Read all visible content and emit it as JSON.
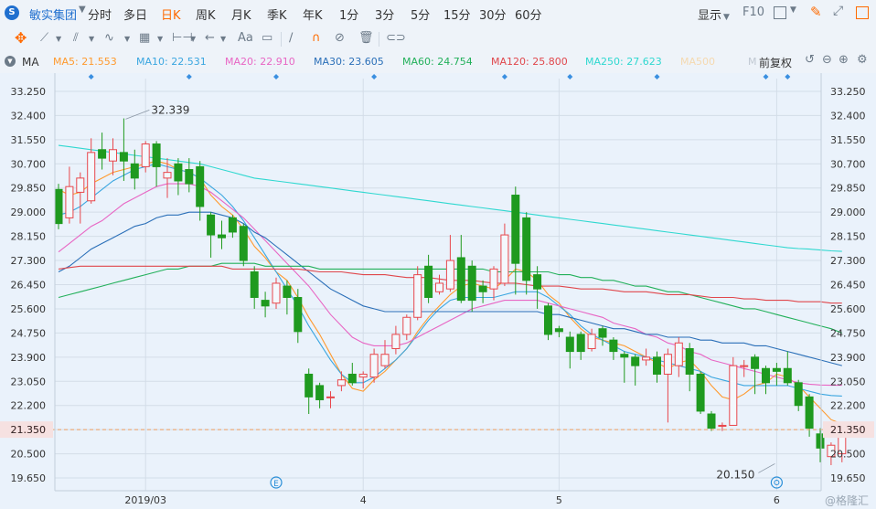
{
  "toolbar": {
    "logo_text": "S",
    "stock_name": "敏实集团",
    "periods": [
      "分时",
      "多日",
      "日K",
      "周K",
      "月K",
      "季K",
      "年K",
      "1分",
      "3分",
      "5分",
      "15分",
      "30分",
      "60分"
    ],
    "active_period": "日K",
    "display_label": "显示",
    "f10_label": "F10"
  },
  "drawing_tools": {
    "text_tool_label": "Aa"
  },
  "indicator_bar": {
    "indicator": "MA",
    "adjust_label": "前复权",
    "ma_items": [
      {
        "label": "MA5: 21.553",
        "color": "#ff9a2e"
      },
      {
        "label": "MA10: 22.531",
        "color": "#3aa6e0"
      },
      {
        "label": "MA20: 22.910",
        "color": "#e866c4"
      },
      {
        "label": "MA30: 23.605",
        "color": "#2a6fb8"
      },
      {
        "label": "MA60: 24.754",
        "color": "#22b05a"
      },
      {
        "label": "MA120: 25.800",
        "color": "#e0474c"
      },
      {
        "label": "MA250: 27.623",
        "color": "#2fd8d0"
      },
      {
        "label": "MA500",
        "color": "#f5d9b0"
      },
      {
        "label": "M",
        "color": "#c0c8d2"
      }
    ]
  },
  "chart_data": {
    "type": "candlestick",
    "ylim": [
      19.2,
      33.7
    ],
    "y_ticks": [
      "33.250",
      "32.400",
      "31.550",
      "30.700",
      "29.850",
      "29.000",
      "28.150",
      "27.300",
      "26.450",
      "25.600",
      "24.750",
      "23.900",
      "23.050",
      "22.200",
      "21.350",
      "20.500",
      "19.650"
    ],
    "x_labels": [
      {
        "label": "2019/03",
        "index": 8
      },
      {
        "label": "4",
        "index": 28
      },
      {
        "label": "5",
        "index": 46
      },
      {
        "label": "6",
        "index": 66
      }
    ],
    "current_price": "21.350",
    "high_annotation": {
      "label": "32.339",
      "index": 6
    },
    "low_annotation": {
      "label": "20.150",
      "index": 66
    },
    "event_markers": {
      "E_index": 20,
      "Q_index": 66
    },
    "top_markers_indices": [
      3,
      12,
      20,
      29,
      41,
      47,
      55,
      65,
      67
    ],
    "colors": {
      "up": "#e8474c",
      "down": "#1f9a1f",
      "bg": "#eaf2fb",
      "grid": "#d3dde8"
    },
    "candles": [
      [
        29.8,
        28.6,
        28.4,
        30.0
      ],
      [
        28.8,
        29.9,
        28.6,
        30.6
      ],
      [
        29.7,
        30.2,
        28.6,
        30.4
      ],
      [
        29.4,
        31.1,
        29.3,
        31.6
      ],
      [
        31.2,
        30.9,
        30.5,
        31.8
      ],
      [
        30.8,
        31.2,
        30.3,
        31.6
      ],
      [
        31.1,
        30.8,
        30.1,
        32.3
      ],
      [
        30.7,
        30.2,
        29.8,
        31.2
      ],
      [
        30.6,
        31.4,
        30.4,
        31.5
      ],
      [
        31.4,
        30.6,
        29.9,
        31.5
      ],
      [
        30.2,
        30.4,
        29.5,
        30.9
      ],
      [
        30.7,
        30.1,
        29.6,
        30.9
      ],
      [
        30.5,
        30.0,
        29.7,
        30.9
      ],
      [
        30.6,
        29.2,
        28.7,
        30.8
      ],
      [
        28.9,
        28.2,
        27.4,
        29.0
      ],
      [
        28.2,
        28.1,
        27.7,
        28.7
      ],
      [
        28.8,
        28.3,
        28.1,
        28.9
      ],
      [
        28.5,
        27.3,
        27.1,
        28.6
      ],
      [
        26.9,
        26.0,
        25.6,
        27.1
      ],
      [
        25.9,
        25.7,
        25.3,
        26.2
      ],
      [
        25.8,
        26.5,
        25.6,
        26.7
      ],
      [
        26.4,
        26.0,
        25.4,
        26.6
      ],
      [
        26.0,
        24.8,
        24.4,
        26.3
      ],
      [
        23.3,
        22.5,
        21.9,
        23.5
      ],
      [
        22.9,
        22.4,
        22.1,
        23.0
      ],
      [
        22.5,
        22.5,
        22.1,
        22.7
      ],
      [
        22.9,
        23.1,
        22.7,
        23.4
      ],
      [
        23.3,
        23.0,
        22.9,
        23.7
      ],
      [
        23.2,
        23.3,
        22.8,
        23.4
      ],
      [
        23.2,
        24.0,
        23.0,
        24.2
      ],
      [
        23.6,
        24.0,
        23.5,
        24.5
      ],
      [
        24.2,
        24.7,
        24.0,
        25.0
      ],
      [
        24.7,
        25.3,
        24.5,
        25.4
      ],
      [
        25.3,
        26.8,
        25.2,
        27.1
      ],
      [
        27.1,
        26.0,
        25.8,
        27.5
      ],
      [
        26.2,
        26.5,
        26.1,
        26.8
      ],
      [
        26.3,
        27.3,
        26.2,
        28.2
      ],
      [
        27.4,
        25.9,
        25.8,
        28.2
      ],
      [
        27.1,
        25.9,
        25.5,
        27.3
      ],
      [
        26.4,
        26.2,
        25.8,
        26.6
      ],
      [
        26.3,
        27.0,
        25.9,
        27.1
      ],
      [
        26.5,
        28.2,
        26.4,
        28.6
      ],
      [
        29.6,
        27.2,
        26.1,
        29.9
      ],
      [
        28.8,
        26.6,
        26.1,
        29.0
      ],
      [
        26.8,
        26.3,
        25.6,
        27.1
      ],
      [
        25.7,
        24.7,
        24.5,
        25.8
      ],
      [
        24.9,
        24.8,
        24.6,
        25.0
      ],
      [
        24.6,
        24.1,
        23.5,
        24.8
      ],
      [
        24.7,
        24.1,
        23.8,
        24.8
      ],
      [
        24.2,
        24.7,
        24.1,
        24.9
      ],
      [
        24.9,
        24.6,
        24.3,
        25.0
      ],
      [
        24.5,
        24.1,
        23.8,
        24.6
      ],
      [
        24.0,
        23.9,
        23.0,
        24.1
      ],
      [
        23.9,
        23.6,
        22.9,
        24.0
      ],
      [
        23.8,
        23.9,
        23.6,
        24.2
      ],
      [
        23.9,
        23.3,
        23.0,
        24.1
      ],
      [
        23.3,
        24.0,
        21.6,
        24.2
      ],
      [
        23.6,
        24.4,
        23.2,
        24.6
      ],
      [
        24.2,
        23.3,
        22.7,
        24.4
      ],
      [
        23.3,
        22.0,
        21.9,
        23.4
      ],
      [
        21.9,
        21.4,
        21.3,
        22.0
      ],
      [
        21.5,
        21.5,
        21.3,
        21.6
      ],
      [
        21.5,
        23.6,
        21.5,
        23.9
      ],
      [
        23.6,
        23.6,
        23.2,
        23.8
      ],
      [
        23.9,
        23.5,
        22.6,
        24.0
      ],
      [
        23.5,
        23.0,
        22.6,
        23.6
      ],
      [
        23.5,
        23.4,
        22.9,
        23.7
      ],
      [
        23.5,
        23.0,
        22.9,
        24.1
      ],
      [
        23.0,
        22.2,
        22.0,
        23.1
      ],
      [
        22.5,
        21.4,
        21.1,
        22.6
      ],
      [
        21.2,
        20.7,
        20.2,
        21.4
      ],
      [
        20.4,
        20.8,
        20.1,
        20.9
      ],
      [
        20.5,
        21.3,
        20.2,
        21.4
      ]
    ],
    "moving_averages": [
      {
        "name": "MA5",
        "color": "#ff9a2e",
        "values": [
          29.8,
          29.6,
          29.7,
          30.0,
          30.2,
          30.4,
          30.5,
          30.6,
          30.7,
          30.8,
          30.7,
          30.5,
          30.4,
          30.2,
          29.6,
          29.2,
          28.9,
          28.4,
          27.8,
          27.4,
          26.9,
          26.6,
          26.0,
          25.3,
          24.7,
          24.0,
          23.3,
          22.8,
          22.7,
          23.1,
          23.4,
          23.8,
          24.2,
          24.8,
          25.3,
          25.7,
          26.1,
          26.4,
          26.5,
          26.4,
          26.3,
          26.6,
          27.0,
          26.9,
          26.6,
          26.1,
          25.8,
          25.3,
          24.9,
          24.6,
          24.5,
          24.4,
          24.3,
          24.1,
          23.9,
          23.7,
          23.5,
          23.7,
          23.8,
          23.4,
          22.9,
          22.5,
          22.4,
          22.6,
          22.9,
          23.0,
          23.3,
          23.2,
          22.9,
          22.5,
          22.1,
          21.7,
          21.55
        ]
      },
      {
        "name": "MA10",
        "color": "#3aa6e0",
        "values": [
          28.9,
          29.0,
          29.2,
          29.5,
          29.8,
          30.1,
          30.3,
          30.5,
          30.6,
          30.7,
          30.6,
          30.5,
          30.4,
          30.2,
          29.9,
          29.6,
          29.2,
          28.7,
          28.1,
          27.5,
          26.9,
          26.3,
          25.7,
          25.0,
          24.4,
          23.8,
          23.3,
          23.0,
          23.0,
          23.2,
          23.5,
          23.8,
          24.2,
          24.7,
          25.2,
          25.6,
          25.9,
          26.0,
          26.0,
          26.0,
          26.0,
          26.1,
          26.2,
          26.2,
          26.2,
          26.0,
          25.7,
          25.4,
          25.0,
          24.7,
          24.5,
          24.3,
          24.1,
          24.0,
          23.9,
          23.8,
          23.7,
          23.6,
          23.5,
          23.4,
          23.2,
          23.1,
          23.0,
          22.9,
          22.9,
          22.9,
          22.9,
          22.9,
          22.8,
          22.7,
          22.6,
          22.55,
          22.53
        ]
      },
      {
        "name": "MA20",
        "color": "#e866c4",
        "values": [
          27.6,
          27.9,
          28.2,
          28.5,
          28.7,
          29.0,
          29.3,
          29.5,
          29.7,
          29.9,
          30.0,
          30.0,
          30.0,
          29.9,
          29.7,
          29.4,
          29.1,
          28.8,
          28.4,
          28.0,
          27.6,
          27.2,
          26.8,
          26.4,
          25.9,
          25.4,
          25.0,
          24.6,
          24.4,
          24.3,
          24.3,
          24.3,
          24.4,
          24.6,
          24.8,
          25.0,
          25.2,
          25.4,
          25.6,
          25.7,
          25.8,
          25.9,
          25.9,
          25.9,
          25.9,
          25.8,
          25.7,
          25.6,
          25.5,
          25.4,
          25.3,
          25.1,
          25.0,
          24.9,
          24.7,
          24.6,
          24.4,
          24.3,
          24.1,
          24.0,
          23.8,
          23.7,
          23.6,
          23.5,
          23.4,
          23.3,
          23.2,
          23.1,
          23.0,
          22.95,
          22.92,
          22.91,
          22.91
        ]
      },
      {
        "name": "MA30",
        "color": "#2a6fb8",
        "values": [
          26.9,
          27.1,
          27.4,
          27.7,
          27.9,
          28.1,
          28.3,
          28.5,
          28.6,
          28.8,
          28.9,
          28.9,
          29.0,
          29.0,
          29.0,
          28.9,
          28.8,
          28.6,
          28.3,
          28.1,
          27.8,
          27.5,
          27.2,
          26.9,
          26.6,
          26.3,
          26.1,
          25.9,
          25.7,
          25.6,
          25.5,
          25.5,
          25.5,
          25.5,
          25.5,
          25.5,
          25.5,
          25.5,
          25.5,
          25.5,
          25.5,
          25.5,
          25.5,
          25.5,
          25.5,
          25.4,
          25.4,
          25.3,
          25.2,
          25.1,
          25.0,
          24.9,
          24.9,
          24.8,
          24.7,
          24.7,
          24.6,
          24.6,
          24.6,
          24.5,
          24.5,
          24.4,
          24.4,
          24.4,
          24.3,
          24.3,
          24.2,
          24.1,
          24.0,
          23.9,
          23.8,
          23.7,
          23.6
        ]
      },
      {
        "name": "MA60",
        "color": "#22b05a",
        "values": [
          26.0,
          26.1,
          26.2,
          26.3,
          26.4,
          26.5,
          26.6,
          26.7,
          26.8,
          26.9,
          27.0,
          27.0,
          27.1,
          27.1,
          27.1,
          27.2,
          27.2,
          27.2,
          27.2,
          27.1,
          27.1,
          27.1,
          27.1,
          27.1,
          27.0,
          27.0,
          27.0,
          27.0,
          27.0,
          27.0,
          27.0,
          27.0,
          27.0,
          27.0,
          27.0,
          27.0,
          27.0,
          27.0,
          27.0,
          27.0,
          26.9,
          26.9,
          26.9,
          26.9,
          26.9,
          26.9,
          26.8,
          26.8,
          26.7,
          26.7,
          26.6,
          26.6,
          26.5,
          26.4,
          26.4,
          26.3,
          26.2,
          26.2,
          26.1,
          26.0,
          25.9,
          25.8,
          25.7,
          25.6,
          25.6,
          25.5,
          25.4,
          25.3,
          25.2,
          25.1,
          25.0,
          24.9,
          24.75
        ]
      },
      {
        "name": "MA120",
        "color": "#e0474c",
        "values": [
          27.0,
          27.05,
          27.1,
          27.1,
          27.1,
          27.1,
          27.1,
          27.1,
          27.1,
          27.1,
          27.1,
          27.1,
          27.1,
          27.1,
          27.1,
          27.1,
          27.0,
          27.0,
          27.0,
          27.0,
          27.0,
          27.0,
          27.0,
          26.95,
          26.9,
          26.9,
          26.9,
          26.85,
          26.8,
          26.8,
          26.8,
          26.75,
          26.7,
          26.7,
          26.7,
          26.65,
          26.6,
          26.6,
          26.6,
          26.55,
          26.5,
          26.5,
          26.5,
          26.45,
          26.4,
          26.4,
          26.4,
          26.35,
          26.3,
          26.3,
          26.3,
          26.25,
          26.2,
          26.2,
          26.2,
          26.15,
          26.1,
          26.1,
          26.1,
          26.05,
          26.0,
          26.0,
          26.0,
          25.95,
          25.95,
          25.9,
          25.9,
          25.9,
          25.85,
          25.85,
          25.85,
          25.8,
          25.8
        ]
      },
      {
        "name": "MA250",
        "color": "#2fd8d0",
        "values": [
          31.35,
          31.3,
          31.25,
          31.2,
          31.15,
          31.1,
          31.05,
          31.0,
          30.95,
          30.9,
          30.85,
          30.8,
          30.75,
          30.7,
          30.6,
          30.5,
          30.4,
          30.3,
          30.2,
          30.15,
          30.1,
          30.05,
          30.0,
          29.95,
          29.9,
          29.85,
          29.8,
          29.75,
          29.7,
          29.65,
          29.6,
          29.55,
          29.5,
          29.45,
          29.4,
          29.35,
          29.3,
          29.25,
          29.2,
          29.15,
          29.1,
          29.05,
          29.0,
          28.95,
          28.9,
          28.85,
          28.8,
          28.75,
          28.7,
          28.65,
          28.6,
          28.55,
          28.5,
          28.45,
          28.4,
          28.35,
          28.3,
          28.25,
          28.2,
          28.15,
          28.1,
          28.05,
          28.0,
          27.95,
          27.9,
          27.85,
          27.8,
          27.75,
          27.72,
          27.7,
          27.67,
          27.64,
          27.62
        ]
      }
    ]
  }
}
